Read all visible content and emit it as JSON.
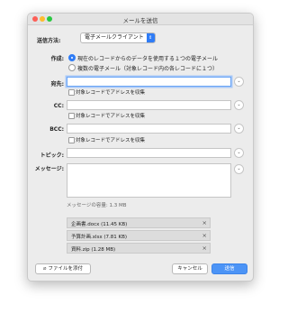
{
  "window": {
    "title": "メールを送信"
  },
  "method": {
    "label": "送信方法:",
    "selected": "電子メールクライアント"
  },
  "create": {
    "label": "作成:",
    "options": [
      {
        "text": "現在のレコードからのデータを使用する１つの電子メール",
        "checked": true
      },
      {
        "text": "複数の電子メール（対象レコード内の各レコードに１つ）",
        "checked": false
      }
    ]
  },
  "to": {
    "label": "宛先:",
    "checkbox_label": "対象レコードでアドレスを収集"
  },
  "cc": {
    "label": "CC:",
    "checkbox_label": "対象レコードでアドレスを収集"
  },
  "bcc": {
    "label": "BCC:",
    "checkbox_label": "対象レコードでアドレスを収集"
  },
  "subject": {
    "label": "トピック:"
  },
  "message": {
    "label": "メッセージ:",
    "size_text": "メッセージの容量:  1.3 MB"
  },
  "attachments": [
    {
      "name": "企画書.docx (11.45 KB)"
    },
    {
      "name": "予算計画.xlsx (7.81 KB)"
    },
    {
      "name": "資料.zip (1.28 MB)"
    }
  ],
  "buttons": {
    "attach": "ファイルを添付",
    "cancel": "キャンセル",
    "send": "送信"
  },
  "colors": {
    "accent": "#2f7cf6",
    "close": "#fd5f57",
    "minimize": "#febc2e",
    "maximize": "#28c840"
  }
}
